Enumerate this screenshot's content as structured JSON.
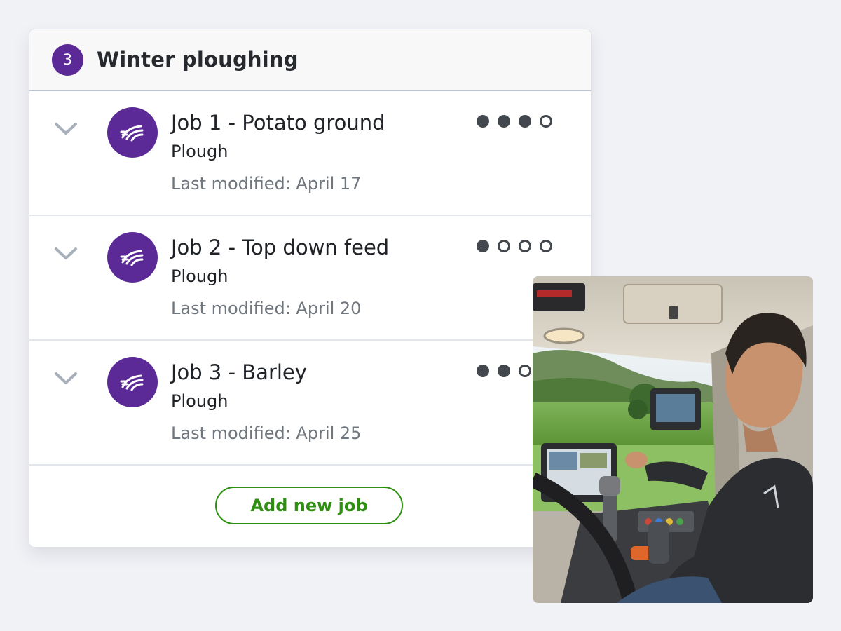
{
  "group": {
    "step_number": "3",
    "title": "Winter ploughing"
  },
  "jobs": [
    {
      "title": "Job 1 - Potato ground",
      "type": "Plough",
      "modified": "Last modified: April 17",
      "progress": {
        "completed": 3,
        "total": 4
      }
    },
    {
      "title": "Job 2 - Top down feed",
      "type": "Plough",
      "modified": "Last modified: April 20",
      "progress": {
        "completed": 1,
        "total": 4
      }
    },
    {
      "title": "Job 3 - Barley",
      "type": "Plough",
      "modified": "Last modified: April 25",
      "progress": {
        "completed": 2,
        "total": 4
      }
    }
  ],
  "actions": {
    "add_job_label": "Add new job"
  },
  "icons": {
    "expand": "chevron-down-icon",
    "job": "plough-field-icon"
  },
  "colors": {
    "brand_purple": "#5b2a97",
    "action_green": "#2e8f12",
    "dot_dark": "#43484e",
    "page_bg": "#f1f2f6"
  }
}
